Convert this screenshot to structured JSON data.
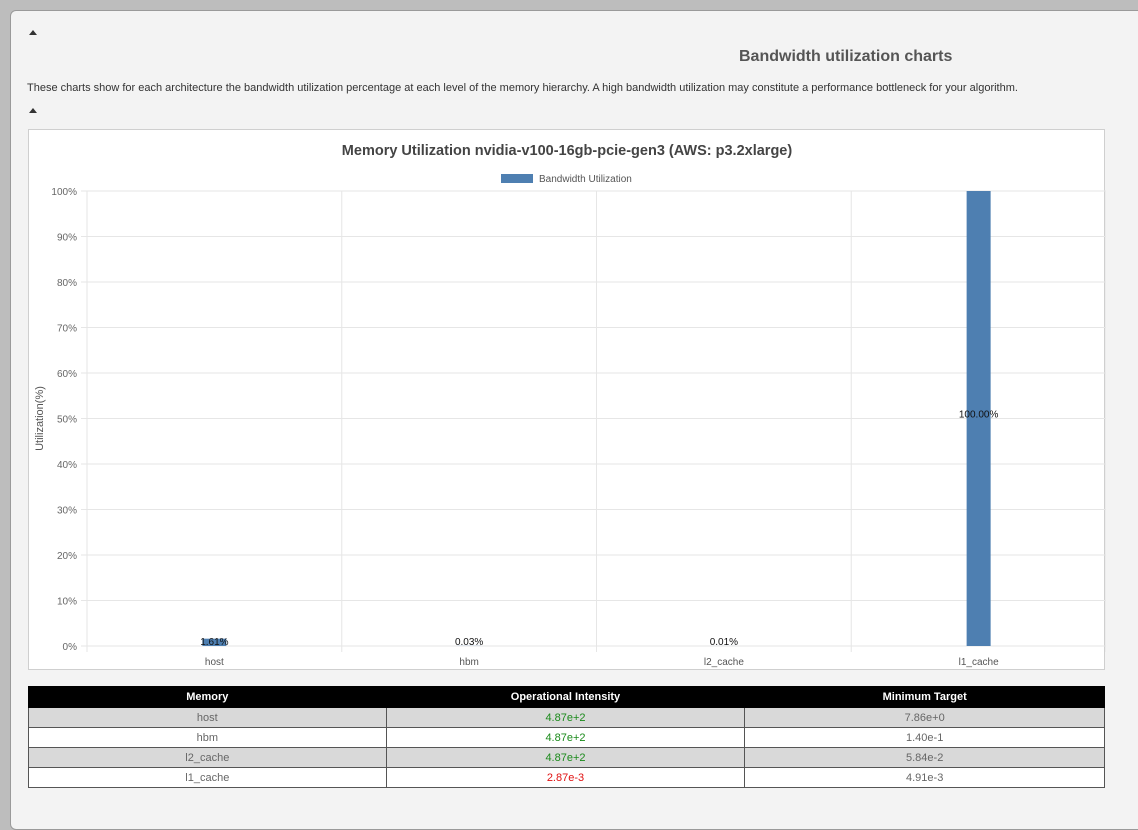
{
  "section": {
    "title": "Bandwidth utilization charts",
    "description": "These charts show for each architecture the bandwidth utilization percentage at each level of the memory hierarchy. A high bandwidth utilization may constitute a performance bottleneck for your algorithm."
  },
  "colors": {
    "bar": "#4e7fb1",
    "good": "#1a8a1a",
    "bad": "#e01010",
    "header_bg": "#000000"
  },
  "chart_data": {
    "type": "bar",
    "title": "Memory Utilization nvidia-v100-16gb-pcie-gen3 (AWS: p3.2xlarge)",
    "xlabel": "",
    "ylabel": "Utilization(%)",
    "ylim": [
      0,
      100
    ],
    "yticks": [
      "0%",
      "10%",
      "20%",
      "30%",
      "40%",
      "50%",
      "60%",
      "70%",
      "80%",
      "90%",
      "100%"
    ],
    "categories": [
      "host",
      "hbm",
      "l2_cache",
      "l1_cache"
    ],
    "series": [
      {
        "name": "Bandwidth Utilization",
        "values": [
          1.61,
          0.03,
          0.01,
          100.0
        ]
      }
    ],
    "data_labels": [
      "1.61%",
      "0.03%",
      "0.01%",
      "100.00%"
    ],
    "legend": "top-center",
    "grid": true
  },
  "table": {
    "headers": [
      "Memory",
      "Operational Intensity",
      "Minimum Target"
    ],
    "rows": [
      {
        "memory": "host",
        "oi": "4.87e+2",
        "oi_status": "good",
        "target": "7.86e+0"
      },
      {
        "memory": "hbm",
        "oi": "4.87e+2",
        "oi_status": "good",
        "target": "1.40e-1"
      },
      {
        "memory": "l2_cache",
        "oi": "4.87e+2",
        "oi_status": "good",
        "target": "5.84e-2"
      },
      {
        "memory": "l1_cache",
        "oi": "2.87e-3",
        "oi_status": "bad",
        "target": "4.91e-3"
      }
    ]
  }
}
